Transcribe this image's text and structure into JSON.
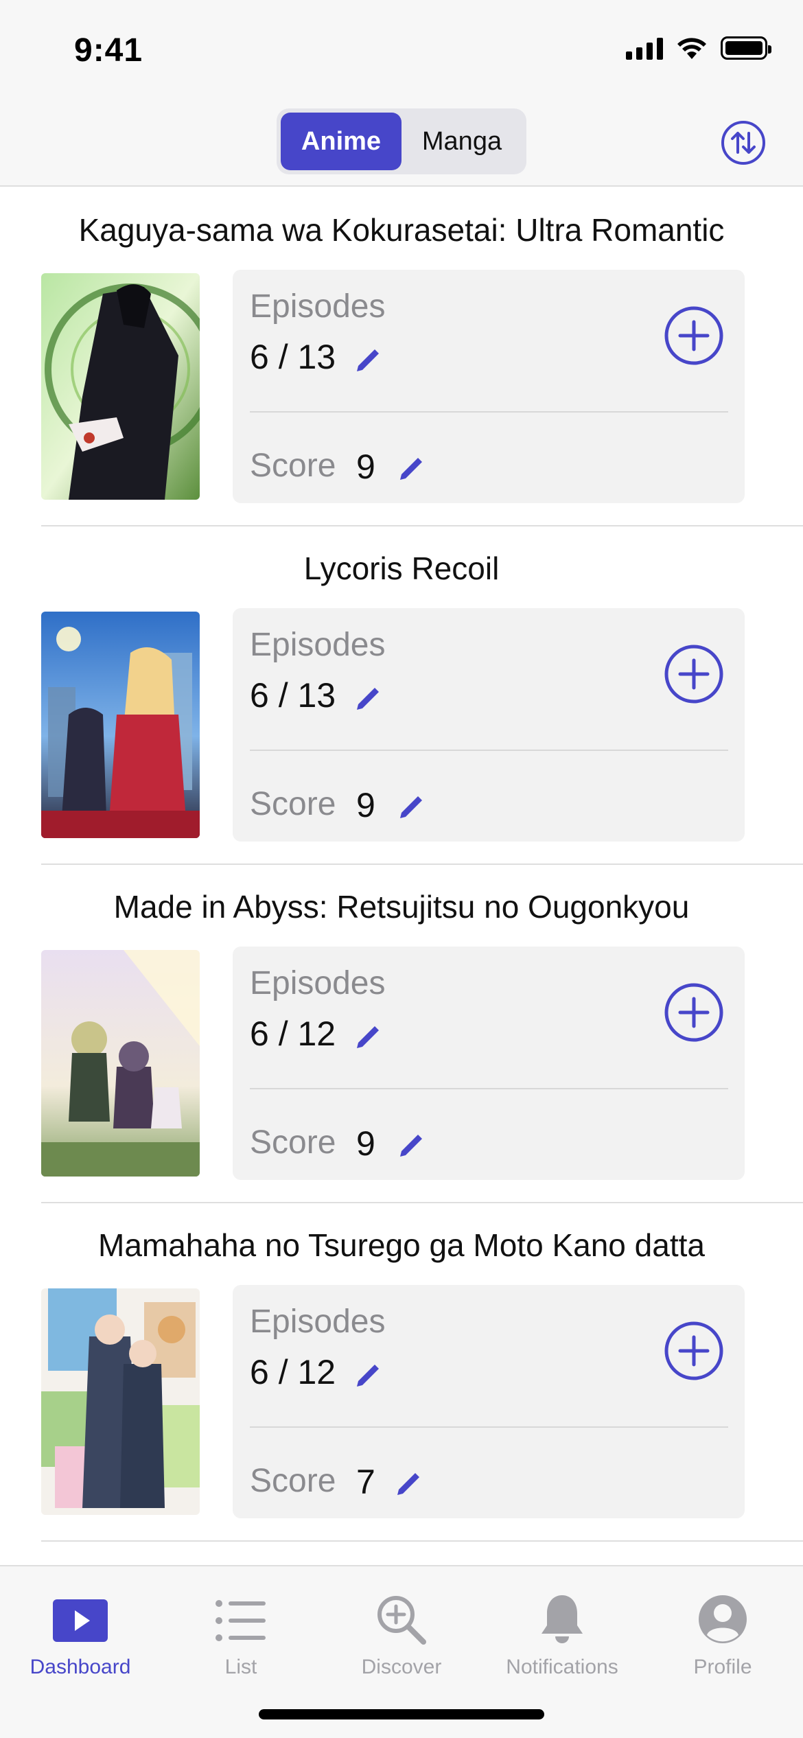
{
  "status_bar": {
    "time": "9:41"
  },
  "header": {
    "segments": [
      "Anime",
      "Manga"
    ],
    "selected_segment": "Anime",
    "sort_icon": "sort-arrows-icon"
  },
  "colors": {
    "accent": "#4746c9",
    "muted": "#8a8a8e",
    "panel": "#f2f2f2"
  },
  "entries": [
    {
      "title": "Kaguya-sama wa Kokurasetai: Ultra Romantic",
      "episodes_label": "Episodes",
      "episodes": "6 / 13",
      "score_label": "Score",
      "score": "9"
    },
    {
      "title": "Lycoris Recoil",
      "episodes_label": "Episodes",
      "episodes": "6 / 13",
      "score_label": "Score",
      "score": "9"
    },
    {
      "title": "Made in Abyss: Retsujitsu no Ougonkyou",
      "episodes_label": "Episodes",
      "episodes": "6 / 12",
      "score_label": "Score",
      "score": "9"
    },
    {
      "title": "Mamahaha no Tsurego ga Moto Kano datta",
      "episodes_label": "Episodes",
      "episodes": "6 / 12",
      "score_label": "Score",
      "score": "7"
    }
  ],
  "tabs": [
    {
      "label": "Dashboard",
      "icon": "play-icon",
      "active": true
    },
    {
      "label": "List",
      "icon": "list-icon",
      "active": false
    },
    {
      "label": "Discover",
      "icon": "magnifier-plus-icon",
      "active": false
    },
    {
      "label": "Notifications",
      "icon": "bell-icon",
      "active": false
    },
    {
      "label": "Profile",
      "icon": "person-circle-icon",
      "active": false
    }
  ]
}
